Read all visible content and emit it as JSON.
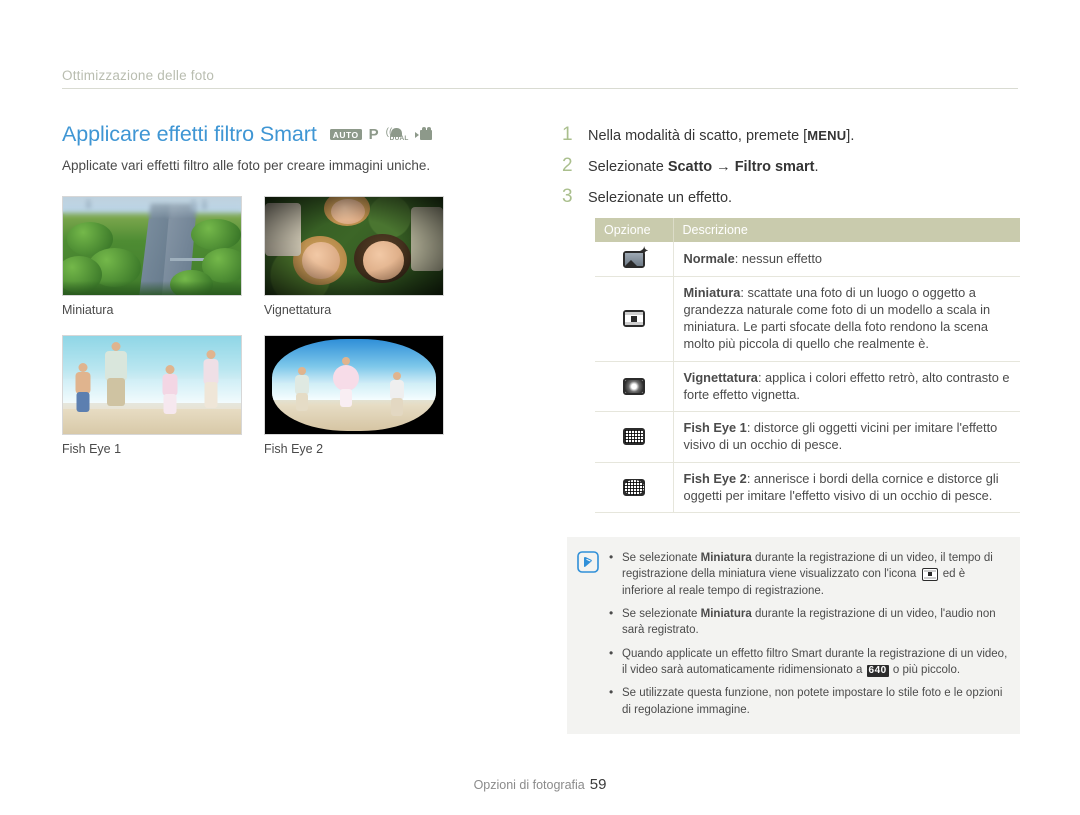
{
  "runhead": {
    "title": "Ottimizzazione delle foto"
  },
  "heading": {
    "title": "Applicare effetti filtro Smart",
    "subtitle": "Applicate vari effetti filtro alle foto per creare immagini uniche.",
    "mode_icons": [
      {
        "name": "auto-mode-icon",
        "label": "AUTO"
      },
      {
        "name": "program-mode-icon",
        "label": "P"
      },
      {
        "name": "dual-is-mode-icon",
        "label": "DUAL"
      },
      {
        "name": "movie-mode-icon",
        "label": ""
      }
    ]
  },
  "samples": [
    {
      "name": "miniature-sample",
      "caption": "Miniatura"
    },
    {
      "name": "vignetting-sample",
      "caption": "Vignettatura"
    },
    {
      "name": "fish-eye-1-sample",
      "caption": "Fish Eye 1"
    },
    {
      "name": "fish-eye-2-sample",
      "caption": "Fish Eye 2"
    }
  ],
  "steps": [
    {
      "num": "1",
      "pre": "Nella modalità di scatto, premete [",
      "kbd": "MENU",
      "post": "]."
    },
    {
      "num": "2",
      "pre": "Selezionate ",
      "b1": "Scatto",
      "arrow": " → ",
      "b2": "Filtro smart",
      "post": "."
    },
    {
      "num": "3",
      "pre": "Selezionate un effetto.",
      "kbd": "",
      "post": ""
    }
  ],
  "table": {
    "headers": [
      "Opzione",
      "Descrizione"
    ],
    "rows": [
      {
        "icon": "normal-filter-icon",
        "term": "Normale",
        "desc": ": nessun effetto"
      },
      {
        "icon": "miniature-filter-icon",
        "term": "Miniatura",
        "desc": ": scattate una foto di un luogo o oggetto a grandezza naturale come foto di un modello a scala in miniatura. Le parti sfocate della foto rendono la scena molto più piccola di quello che realmente è."
      },
      {
        "icon": "vignetting-filter-icon",
        "term": "Vignettatura",
        "desc": ": applica i colori effetto retrò, alto contrasto e forte effetto vignetta."
      },
      {
        "icon": "fish-eye-1-filter-icon",
        "term": "Fish Eye 1",
        "desc": ": distorce gli oggetti vicini per imitare l'effetto visivo di un occhio di pesce."
      },
      {
        "icon": "fish-eye-2-filter-icon",
        "term": "Fish Eye 2",
        "desc": ": annerisce i bordi della cornice e distorce gli oggetti per imitare l'effetto visivo di un occhio di pesce."
      }
    ]
  },
  "note": {
    "icon": "note-pen-icon",
    "items": [
      {
        "p1": "Se selezionate ",
        "b1": "Miniatura",
        "p2": " durante la registrazione di un video, il tempo di registrazione della miniatura viene visualizzato con l'icona ",
        "inline_icon": "miniature-filter-icon",
        "p3": " ed è inferiore al reale tempo di registrazione."
      },
      {
        "p1": "Se selezionate ",
        "b1": "Miniatura",
        "p2": " durante la registrazione di un video, l'audio non sarà registrato.",
        "p3": ""
      },
      {
        "p1": "Quando applicate un effetto filtro Smart durante la registrazione di un video, il video sarà automaticamente ridimensionato a ",
        "badge": "640",
        "p3": " o più piccolo."
      },
      {
        "p1": "Se utilizzate questa funzione, non potete impostare lo stile foto e le opzioni di regolazione immagine.",
        "p3": ""
      }
    ]
  },
  "footer": {
    "section": "Opzioni di fotografia",
    "page": "59"
  },
  "colors": {
    "heading": "#3f96d4",
    "runhead": "#b9bdb0",
    "table_header_bg": "#c9cbad",
    "step_number": "#aabf8d",
    "note_bg": "#f3f3f1",
    "note_icon": "#2f8fd8"
  }
}
